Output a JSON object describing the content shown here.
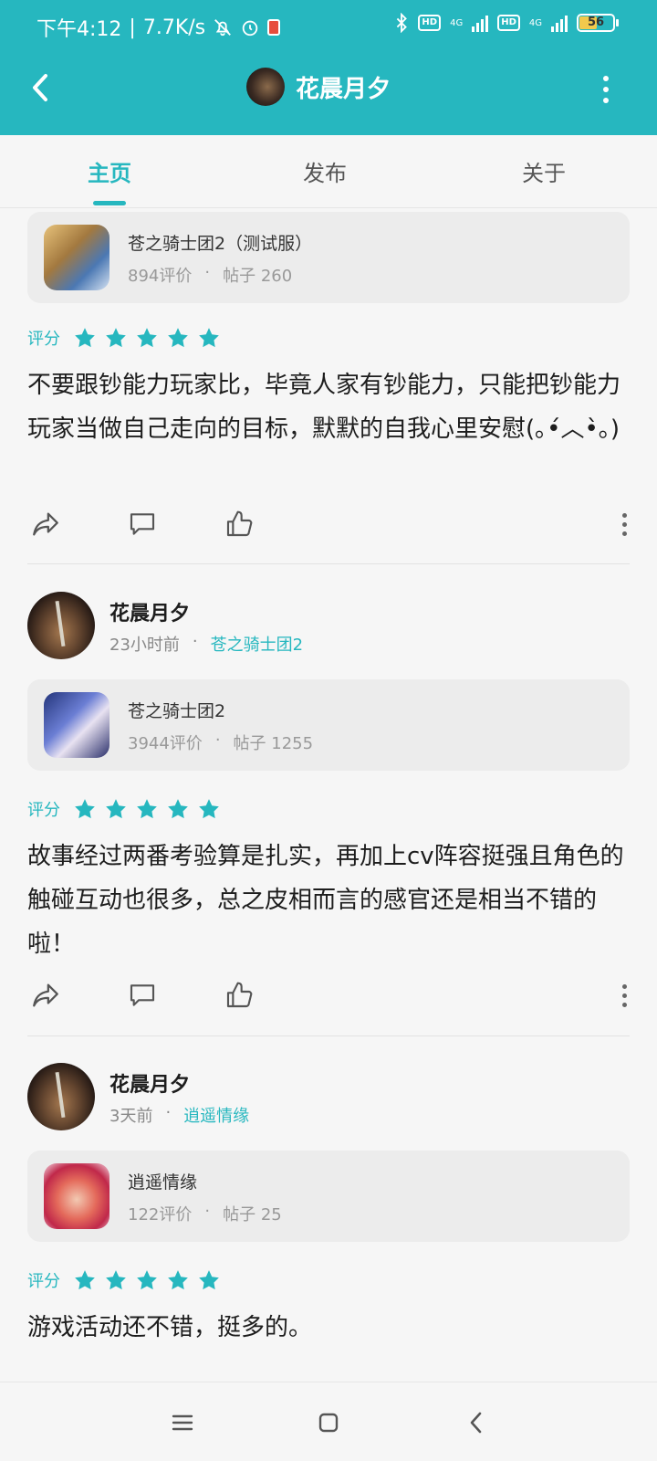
{
  "status_bar": {
    "time": "下午4:12",
    "speed": "7.7K/s",
    "battery": "56",
    "net1": "4G",
    "net2": "4G",
    "hd": "HD"
  },
  "header": {
    "title": "花晨月夕",
    "back_icon": "chevron-left-icon",
    "more_icon": "more-vertical-icon"
  },
  "tabs": [
    {
      "label": "主页",
      "active": true
    },
    {
      "label": "发布",
      "active": false
    },
    {
      "label": "关于",
      "active": false
    }
  ],
  "theme": {
    "accent": "#26b7bf",
    "star": "#26b7bf"
  },
  "posts": [
    {
      "game": {
        "name": "苍之骑士团2（测试服）",
        "reviews": "894评价",
        "posts": "帖子 260"
      },
      "rating_label": "评分",
      "stars": 5,
      "text": "不要跟钞能力玩家比，毕竟人家有钞能力，只能把钞能力玩家当做自己走向的目标，默默的自我心里安慰(｡•́︿•̀｡)"
    },
    {
      "user": {
        "name": "花晨月夕",
        "time": "23小时前",
        "game_link": "苍之骑士团2",
        "sep": "·"
      },
      "game": {
        "name": "苍之骑士团2",
        "reviews": "3944评价",
        "posts": "帖子 1255"
      },
      "rating_label": "评分",
      "stars": 5,
      "text": "故事经过两番考验算是扎实，再加上cv阵容挺强且角色的触碰互动也很多，总之皮相而言的感官还是相当不错的啦！"
    },
    {
      "user": {
        "name": "花晨月夕",
        "time": "3天前",
        "game_link": "逍遥情缘",
        "sep": "·"
      },
      "game": {
        "name": "逍遥情缘",
        "reviews": "122评价",
        "posts": "帖子 25"
      },
      "rating_label": "评分",
      "stars": 5,
      "text": "游戏活动还不错，挺多的。"
    }
  ],
  "game_sep": "·",
  "action_icons": [
    "share-icon",
    "comment-icon",
    "like-icon",
    "more-icon"
  ],
  "nav_icons": [
    "menu-icon",
    "home-square-icon",
    "back-triangle-icon"
  ]
}
